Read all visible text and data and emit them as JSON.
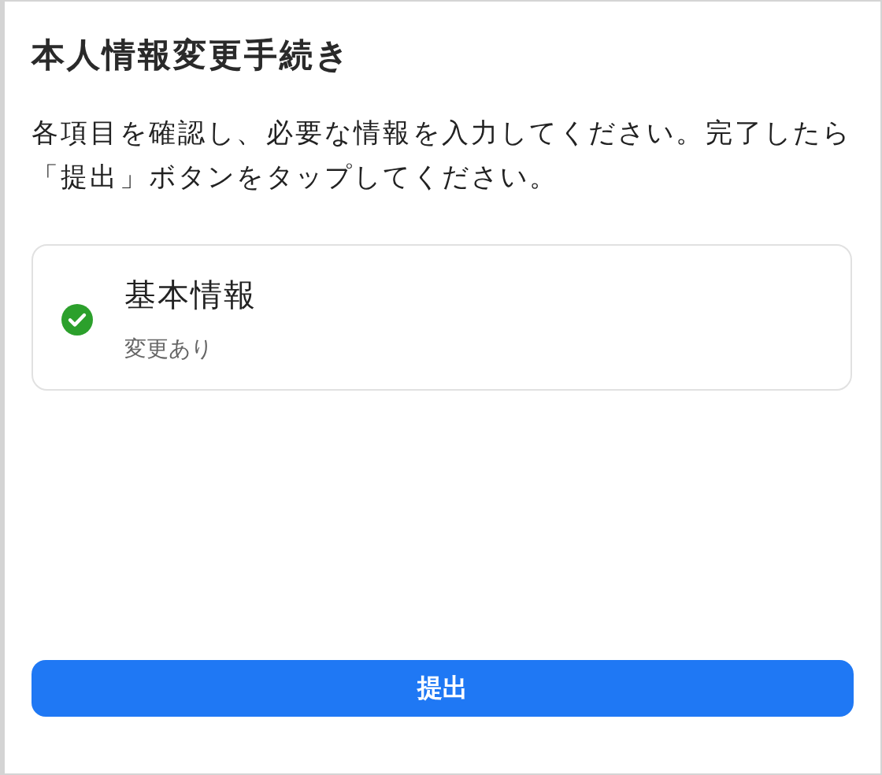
{
  "title": "本人情報変更手続き",
  "instructions": "各項目を確認し、必要な情報を入力してください。完了したら「提出」ボタンをタップしてください。",
  "sections": [
    {
      "title": "基本情報",
      "status": "変更あり",
      "completed": true
    }
  ],
  "submit_button": {
    "label": "提出"
  }
}
